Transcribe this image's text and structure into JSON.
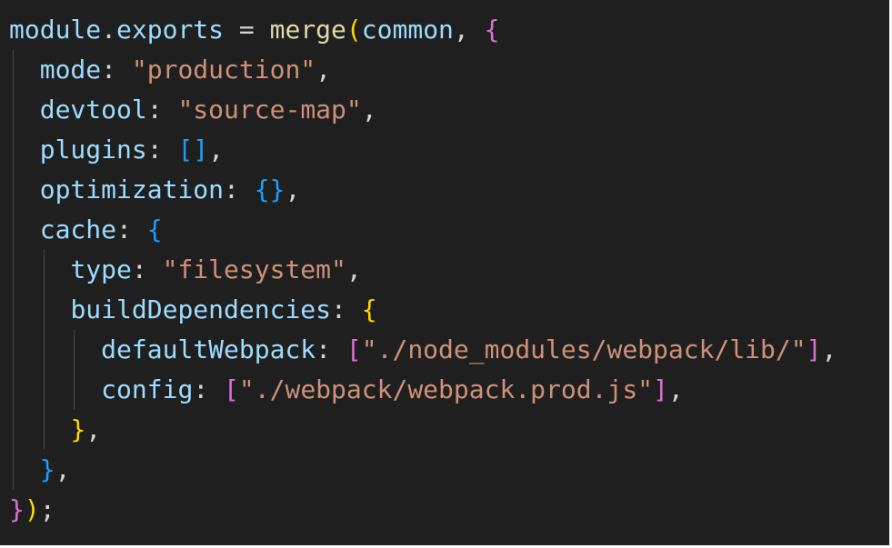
{
  "editor": {
    "language": "javascript",
    "colors": {
      "background": "#1f1f1f",
      "variable": "#9cdcfe",
      "property": "#9cdcfe",
      "function": "#dcdcaa",
      "string": "#ce9178",
      "punctuation": "#d4d4d4",
      "bracket_level_1": "#ffd700",
      "bracket_level_2": "#da70d6",
      "bracket_level_3": "#179fff",
      "indent_guide": "#4a4a4a"
    },
    "lines": [
      {
        "indent": 0,
        "tokens": [
          {
            "text": "module",
            "kind": "var"
          },
          {
            "text": ".",
            "kind": "punc"
          },
          {
            "text": "exports",
            "kind": "prop"
          },
          {
            "text": " = ",
            "kind": "op"
          },
          {
            "text": "merge",
            "kind": "fn"
          },
          {
            "text": "(",
            "kind": "b1"
          },
          {
            "text": "common",
            "kind": "var"
          },
          {
            "text": ", ",
            "kind": "punc"
          },
          {
            "text": "{",
            "kind": "b2"
          }
        ]
      },
      {
        "indent": 1,
        "tokens": [
          {
            "text": "mode",
            "kind": "prop"
          },
          {
            "text": ": ",
            "kind": "punc"
          },
          {
            "text": "\"production\"",
            "kind": "str"
          },
          {
            "text": ",",
            "kind": "punc"
          }
        ]
      },
      {
        "indent": 1,
        "tokens": [
          {
            "text": "devtool",
            "kind": "prop"
          },
          {
            "text": ": ",
            "kind": "punc"
          },
          {
            "text": "\"source-map\"",
            "kind": "str"
          },
          {
            "text": ",",
            "kind": "punc"
          }
        ]
      },
      {
        "indent": 1,
        "tokens": [
          {
            "text": "plugins",
            "kind": "prop"
          },
          {
            "text": ": ",
            "kind": "punc"
          },
          {
            "text": "[]",
            "kind": "b3"
          },
          {
            "text": ",",
            "kind": "punc"
          }
        ]
      },
      {
        "indent": 1,
        "tokens": [
          {
            "text": "optimization",
            "kind": "prop"
          },
          {
            "text": ": ",
            "kind": "punc"
          },
          {
            "text": "{}",
            "kind": "b3"
          },
          {
            "text": ",",
            "kind": "punc"
          }
        ]
      },
      {
        "indent": 1,
        "tokens": [
          {
            "text": "cache",
            "kind": "prop"
          },
          {
            "text": ": ",
            "kind": "punc"
          },
          {
            "text": "{",
            "kind": "b3"
          }
        ]
      },
      {
        "indent": 2,
        "tokens": [
          {
            "text": "type",
            "kind": "prop"
          },
          {
            "text": ": ",
            "kind": "punc"
          },
          {
            "text": "\"filesystem\"",
            "kind": "str"
          },
          {
            "text": ",",
            "kind": "punc"
          }
        ]
      },
      {
        "indent": 2,
        "tokens": [
          {
            "text": "buildDependencies",
            "kind": "prop"
          },
          {
            "text": ": ",
            "kind": "punc"
          },
          {
            "text": "{",
            "kind": "b1"
          }
        ]
      },
      {
        "indent": 3,
        "tokens": [
          {
            "text": "defaultWebpack",
            "kind": "prop"
          },
          {
            "text": ": ",
            "kind": "punc"
          },
          {
            "text": "[",
            "kind": "b2"
          },
          {
            "text": "\"./node_modules/webpack/lib/\"",
            "kind": "str"
          },
          {
            "text": "]",
            "kind": "b2"
          },
          {
            "text": ",",
            "kind": "punc"
          }
        ]
      },
      {
        "indent": 3,
        "tokens": [
          {
            "text": "config",
            "kind": "prop"
          },
          {
            "text": ": ",
            "kind": "punc"
          },
          {
            "text": "[",
            "kind": "b2"
          },
          {
            "text": "\"./webpack/webpack.prod.js\"",
            "kind": "str"
          },
          {
            "text": "]",
            "kind": "b2"
          },
          {
            "text": ",",
            "kind": "punc"
          }
        ]
      },
      {
        "indent": 2,
        "tokens": [
          {
            "text": "}",
            "kind": "b1"
          },
          {
            "text": ",",
            "kind": "punc"
          }
        ]
      },
      {
        "indent": 1,
        "tokens": [
          {
            "text": "}",
            "kind": "b3"
          },
          {
            "text": ",",
            "kind": "punc"
          }
        ]
      },
      {
        "indent": 0,
        "tokens": [
          {
            "text": "}",
            "kind": "b2"
          },
          {
            "text": ")",
            "kind": "b1"
          },
          {
            "text": ";",
            "kind": "punc"
          }
        ]
      }
    ]
  }
}
